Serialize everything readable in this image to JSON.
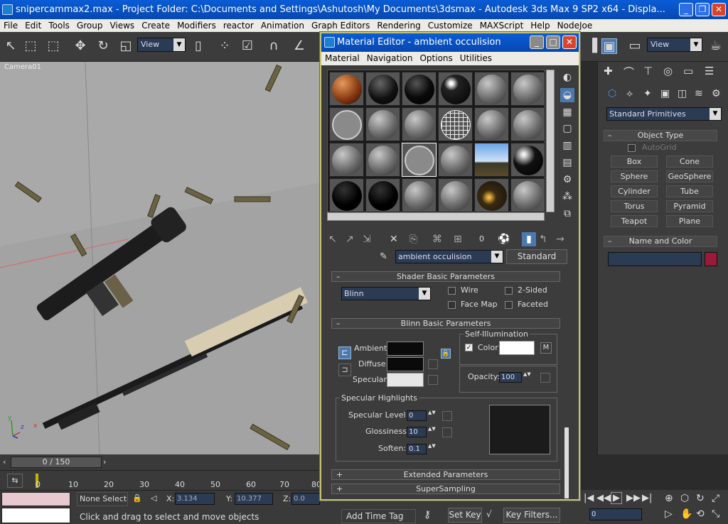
{
  "app": {
    "title": "snipercammax2.max      - Project Folder: C:\\Documents and Settings\\Ashutosh\\My Documents\\3dsmax      - Autodesk 3ds Max 9 SP2 x64      - Displa...",
    "menu": [
      "File",
      "Edit",
      "Tools",
      "Group",
      "Views",
      "Create",
      "Modifiers",
      "reactor",
      "Animation",
      "Graph Editors",
      "Rendering",
      "Customize",
      "MAXScript",
      "Help",
      "NodeJoe"
    ],
    "toolbar_view": "View",
    "toolbar_view_right": "View"
  },
  "viewport": {
    "label": "Camera01",
    "axis_x": "x",
    "axis_y": "y",
    "axis_z": "z"
  },
  "timeline": {
    "slider_text": "0 / 150",
    "ticks": [
      "0",
      "10",
      "20",
      "30",
      "40",
      "50",
      "60",
      "70",
      "80"
    ]
  },
  "status": {
    "selection": "None Selecte",
    "x_label": "X:",
    "x_value": "3.134",
    "y_label": "Y:",
    "y_value": "10.377",
    "z_label": "Z:",
    "z_value": "0.0",
    "prompt": "Click and drag to select and move objects",
    "add_time_tag": "Add Time Tag",
    "set_key": "Set Key",
    "key_filters": "Key Filters...",
    "frame_value": "0"
  },
  "command_panel": {
    "category": "Standard Primitives",
    "object_type_title": "Object Type",
    "autogrid": "AutoGrid",
    "buttons": [
      "Box",
      "Cone",
      "Sphere",
      "GeoSphere",
      "Cylinder",
      "Tube",
      "Torus",
      "Pyramid",
      "Teapot",
      "Plane"
    ],
    "name_color_title": "Name and Color",
    "name_value": "",
    "color": "#9b1a3a"
  },
  "material_editor": {
    "title": "Material Editor - ambient occulision",
    "menu": [
      "Material",
      "Navigation",
      "Options",
      "Utilities"
    ],
    "id_value": "0",
    "material_name": "ambient occulision",
    "material_type": "Standard",
    "shader_rollout": "Shader Basic Parameters",
    "shader": "Blinn",
    "wire": "Wire",
    "two_sided": "2-Sided",
    "face_map": "Face Map",
    "faceted": "Faceted",
    "blinn_rollout": "Blinn Basic Parameters",
    "self_illum_title": "Self-Illumination",
    "self_illum_color_label": "Color",
    "self_illum_m": "M",
    "ambient_label": "Ambient:",
    "diffuse_label": "Diffuse:",
    "specular_label": "Specular:",
    "opacity_label": "Opacity:",
    "opacity_value": "100",
    "spec_highlights_title": "Specular Highlights",
    "spec_level_label": "Specular Level:",
    "spec_level_value": "0",
    "glossiness_label": "Glossiness:",
    "glossiness_value": "10",
    "soften_label": "Soften:",
    "soften_value": "0.1",
    "extended_rollout": "Extended Parameters",
    "supersampling_rollout": "SuperSampling",
    "ambient_color": "#0a0a0a",
    "diffuse_color": "#0a0a0a",
    "specular_color": "#e6e6e6",
    "self_illum_color": "#ffffff"
  }
}
